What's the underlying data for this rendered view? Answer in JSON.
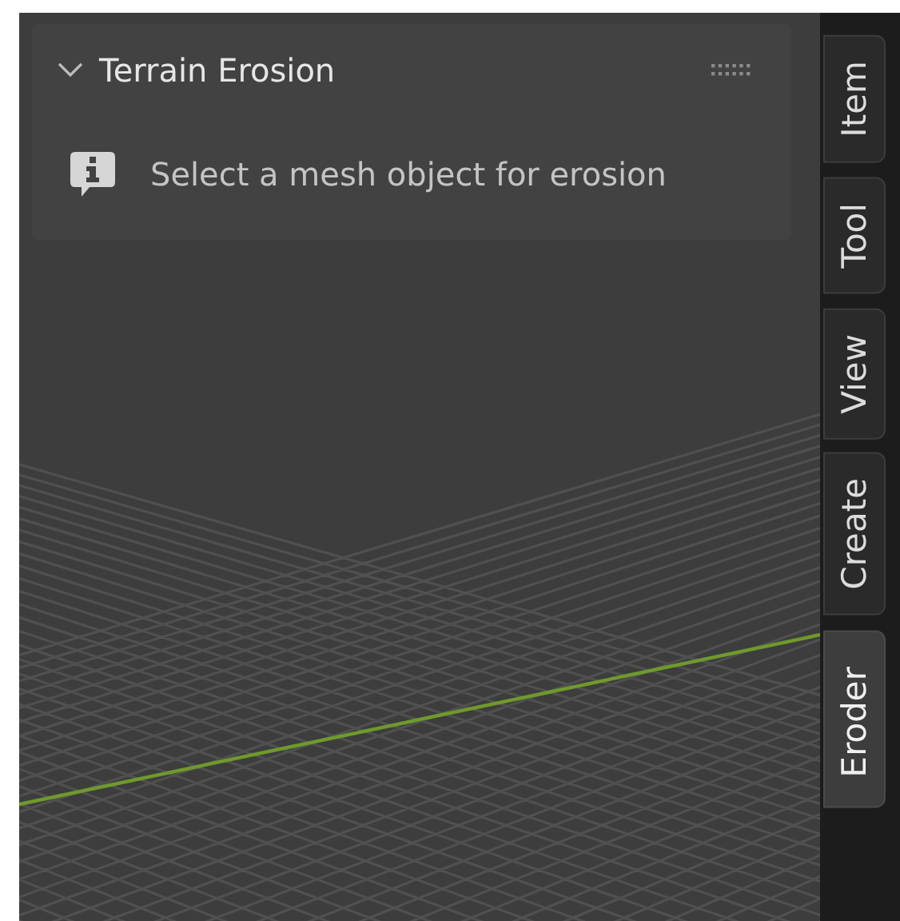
{
  "panel": {
    "title": "Terrain Erosion",
    "expanded": true,
    "message": "Select a mesh object for erosion"
  },
  "tabs": [
    {
      "label": "Item",
      "selected": false
    },
    {
      "label": "Tool",
      "selected": false
    },
    {
      "label": "View",
      "selected": false
    },
    {
      "label": "Create",
      "selected": false
    },
    {
      "label": "Eroder",
      "selected": true
    }
  ]
}
